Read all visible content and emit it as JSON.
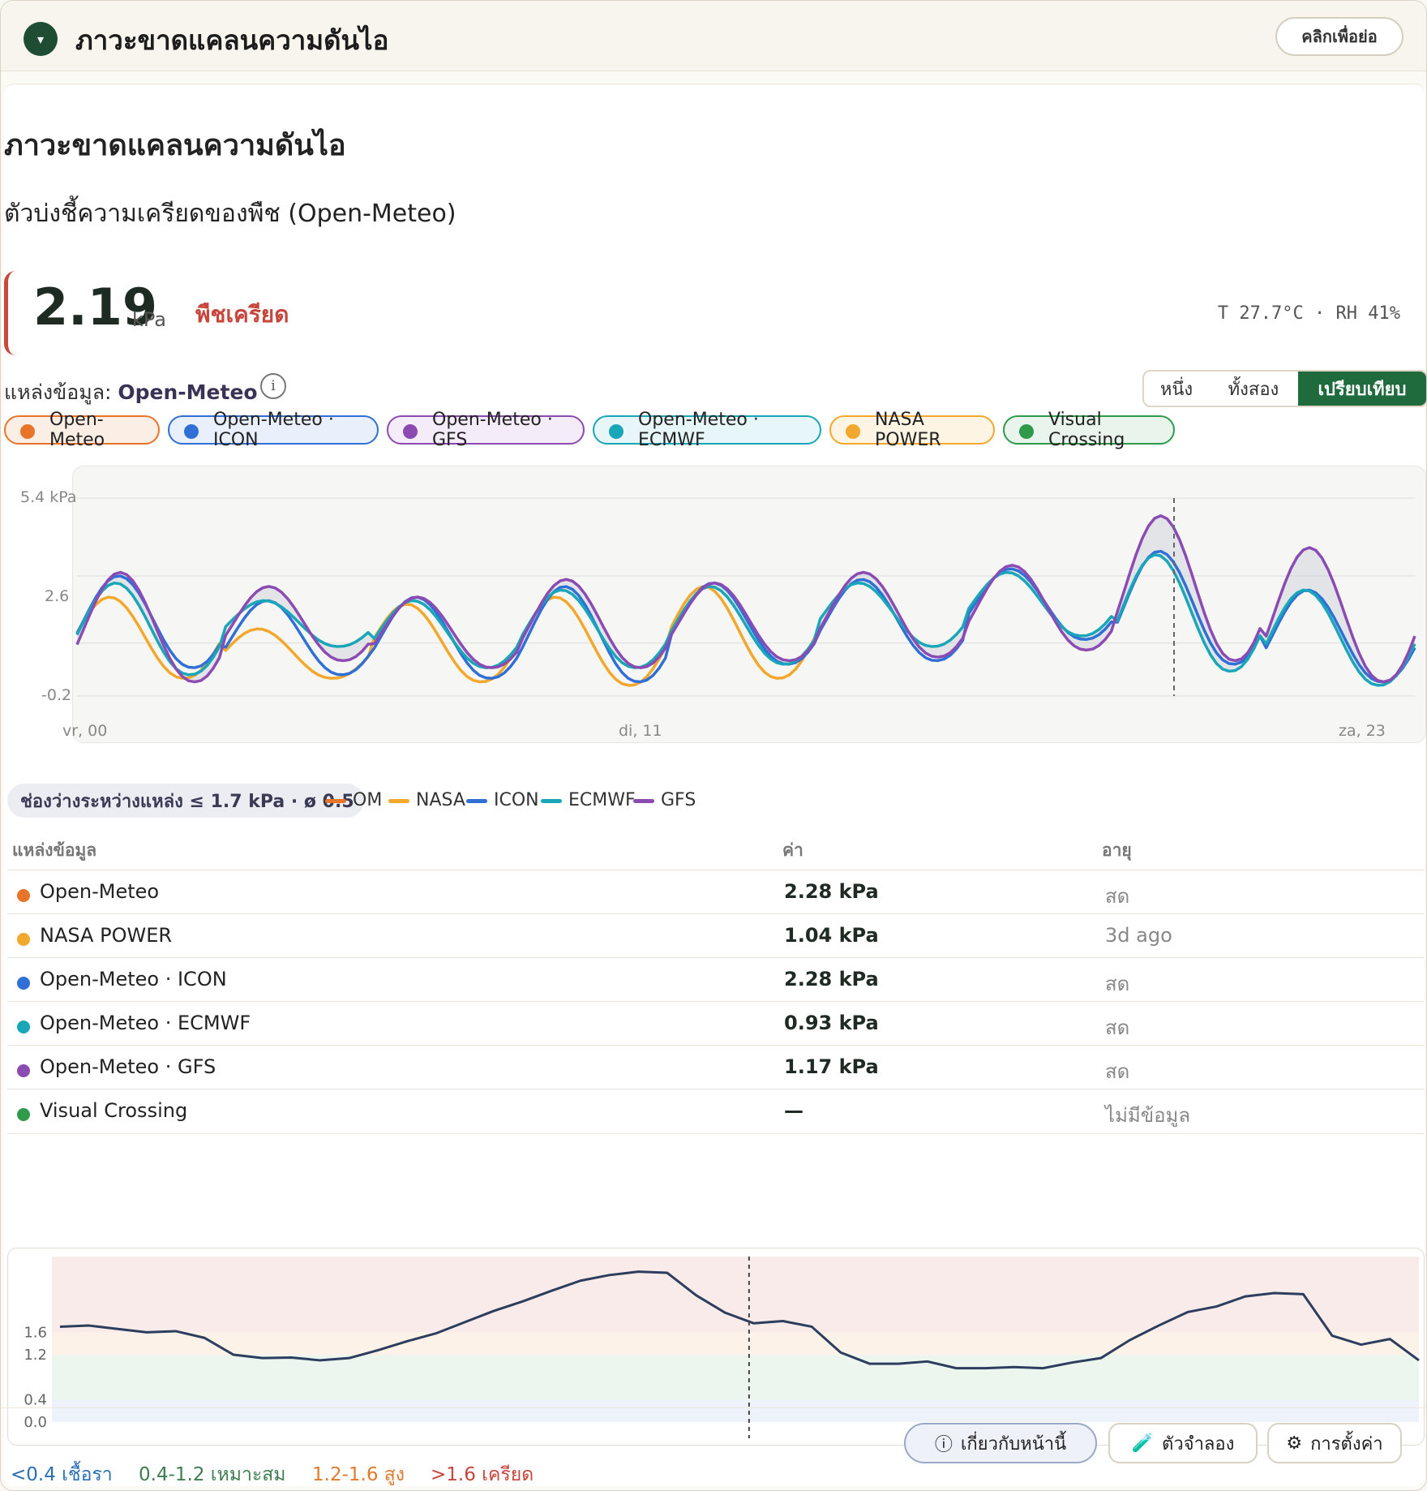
{
  "header": {
    "title": "ภาวะขาดแคลนความดันไอ",
    "collapse_label": "คลิกเพื่อย่อ",
    "toggle_icon": "▾"
  },
  "panel": {
    "title": "ภาวะขาดแคลนความดันไอ",
    "subtitle": "ตัวบ่งชี้ความเครียดของพืช (Open-Meteo)",
    "value": "2.19",
    "unit": "kPa",
    "status": "พืชเครียด",
    "status_color": "#c7453a",
    "readout": "T 27.7°C · RH 41%",
    "source_prefix": "แหล่งข้อมูล:",
    "source_name": "Open-Meteo",
    "info_glyph": "i",
    "modes": [
      "หนึ่ง",
      "ทั้งสอง",
      "เปรียบเทียบ"
    ],
    "active_mode": "เปรียบเทียบ"
  },
  "chips": [
    {
      "label": "Open-Meteo",
      "color": "#e8742a",
      "bg": "#fbeee4"
    },
    {
      "label": "Open-Meteo · ICON",
      "color": "#2f6fd6",
      "bg": "#eaf0fb"
    },
    {
      "label": "Open-Meteo · GFS",
      "color": "#8b4bb3",
      "bg": "#f4ecf8"
    },
    {
      "label": "Open-Meteo · ECMWF",
      "color": "#19a6b8",
      "bg": "#e7f6f8"
    },
    {
      "label": "NASA POWER",
      "color": "#f2a72d",
      "bg": "#fdf4e4"
    },
    {
      "label": "Visual Crossing",
      "color": "#2f9a4a",
      "bg": "#e9f5ec"
    }
  ],
  "chart_data": [
    {
      "type": "line",
      "title": "",
      "ylabel": "kPa",
      "y_ticks": [
        "5.4 kPa",
        "2.6",
        "-0.2"
      ],
      "x_ticks": [
        "vr, 00",
        "di, 11",
        "za, 23"
      ],
      "ylim": [
        -0.2,
        5.4
      ],
      "grid": true,
      "now_marker_fraction": 0.82,
      "series": [
        {
          "name": "OM",
          "color": "#e8742a"
        },
        {
          "name": "NASA",
          "color": "#f2a72d"
        },
        {
          "name": "ICON",
          "color": "#2f6fd6"
        },
        {
          "name": "ECMWF",
          "color": "#19a6b8"
        },
        {
          "name": "GFS",
          "color": "#8b4bb3"
        }
      ],
      "daily_peaks": {
        "NASA": [
          2.6,
          1.7,
          2.4,
          2.6,
          2.9
        ],
        "ICON": [
          3.2,
          2.5,
          2.6,
          2.9,
          3.0,
          3.1,
          3.4,
          3.9,
          2.8
        ],
        "ECMWF": [
          3.0,
          2.5,
          2.5,
          2.8,
          2.9,
          3.0,
          3.3,
          3.8,
          2.8
        ],
        "GFS": [
          3.3,
          2.9,
          2.6,
          3.1,
          3.0,
          3.3,
          3.5,
          4.9,
          4.0
        ]
      },
      "daily_lows": {
        "NASA": [
          0.3,
          0.3,
          0.2,
          0.1,
          0.3
        ],
        "ICON": [
          0.6,
          0.4,
          0.3,
          0.2,
          0.7,
          0.8,
          1.4,
          0.7,
          0.2
        ],
        "ECMWF": [
          0.4,
          1.2,
          0.6,
          0.6,
          0.7,
          1.2,
          1.5,
          0.5,
          0.1
        ],
        "GFS": [
          0.2,
          0.8,
          0.6,
          0.6,
          0.8,
          0.9,
          1.1,
          0.8,
          0.2
        ]
      }
    },
    {
      "type": "line",
      "title": "",
      "y_ticks": [
        "1.6",
        "1.2",
        "0.4",
        "0.0"
      ],
      "zones": [
        {
          "label": "<0.4 เชื้อรา",
          "from": 0,
          "to": 0.4,
          "color": "#2b6fb5"
        },
        {
          "label": "0.4-1.2 เหมาะสม",
          "from": 0.4,
          "to": 1.2,
          "color": "#3e7d4f"
        },
        {
          "label": "1.2-1.6 สูง",
          "from": 1.2,
          "to": 1.6,
          "color": "#e07a2f"
        },
        {
          "label": ">1.6 เครียด",
          "from": 1.6,
          "to": 5.0,
          "color": "#c7453a"
        }
      ],
      "now_marker_fraction": 0.51,
      "values": [
        1.7,
        1.72,
        1.66,
        1.6,
        1.62,
        1.5,
        1.2,
        1.14,
        1.15,
        1.1,
        1.14,
        1.28,
        1.44,
        1.58,
        1.78,
        1.98,
        2.15,
        2.34,
        2.52,
        2.62,
        2.68,
        2.66,
        2.26,
        1.95,
        1.76,
        1.8,
        1.7,
        1.24,
        1.04,
        1.04,
        1.08,
        0.96,
        0.96,
        0.98,
        0.96,
        1.06,
        1.14,
        1.46,
        1.72,
        1.96,
        2.06,
        2.24,
        2.3,
        2.28,
        1.54,
        1.38,
        1.48,
        1.1
      ]
    }
  ],
  "gap_summary": "ช่องว่างระหว่างแหล่ง ≤ 1.7 kPa · ø 0.5",
  "table": {
    "headers": [
      "แหล่งข้อมูล",
      "ค่า",
      "อายุ"
    ],
    "rows": [
      {
        "name": "Open-Meteo",
        "value": "2.28 kPa",
        "age": "สด",
        "color": "#e8742a"
      },
      {
        "name": "NASA POWER",
        "value": "1.04 kPa",
        "age": "3d ago",
        "color": "#f2a72d"
      },
      {
        "name": "Open-Meteo · ICON",
        "value": "2.28 kPa",
        "age": "สด",
        "color": "#2f6fd6"
      },
      {
        "name": "Open-Meteo · ECMWF",
        "value": "0.93 kPa",
        "age": "สด",
        "color": "#19a6b8"
      },
      {
        "name": "Open-Meteo · GFS",
        "value": "1.17 kPa",
        "age": "สด",
        "color": "#8b4bb3"
      },
      {
        "name": "Visual Crossing",
        "value": "—",
        "age": "ไม่มีข้อมูล",
        "color": "#2f9a4a"
      }
    ]
  },
  "footer": {
    "about_label": "เกี่ยวกับหน้านี้",
    "simulator_label": "ตัวจำลอง",
    "settings_label": "การตั้งค่า",
    "about_icon": "ⓘ",
    "simulator_icon": "🧪",
    "settings_icon": "⚙"
  }
}
